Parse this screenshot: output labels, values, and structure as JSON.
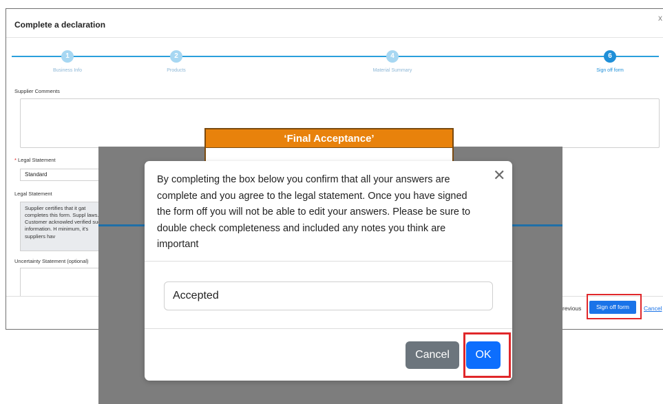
{
  "window": {
    "title": "Complete a declaration",
    "close_glyph": "x"
  },
  "stepper": {
    "steps": [
      {
        "number": "1",
        "label": "Business Info"
      },
      {
        "number": "2",
        "label": "Products"
      },
      {
        "number": "4",
        "label": "Material Summary"
      },
      {
        "number": "6",
        "label": "Sign off form"
      }
    ],
    "accent_color": "#1f8fd8"
  },
  "form": {
    "supplier_comments_label": "Supplier Comments",
    "legal_statement_type_label": "Legal Statement",
    "required_marker": "*",
    "legal_statement_type_value": "Standard",
    "legal_statement_label": "Legal Statement",
    "legal_statement_text": "Supplier certifies that it gat completes this form. Suppl laws. Customer acknowled verified such information. H minimum, it's suppliers hav",
    "uncertainty_label": "Uncertainty Statement (optional)"
  },
  "footer": {
    "previous_label": "revious",
    "signoff_label": "Sign off form",
    "cancel_label": "Cancel"
  },
  "annotation": {
    "banner_text": "‘Final Acceptance’",
    "banner_color": "#e8820c",
    "highlight_color": "#e0272a"
  },
  "modal": {
    "body_text": "By completing the box below you confirm that all your answers are complete and you agree to the legal statement. Once you have signed the form off you will not be able to edit your answers. Please be sure to double check completeness and included any notes you think are important",
    "close_glyph": "✕",
    "input_value": "Accepted",
    "cancel_label": "Cancel",
    "ok_label": "OK",
    "ok_color": "#0d6efd",
    "cancel_color": "#6c757d"
  }
}
